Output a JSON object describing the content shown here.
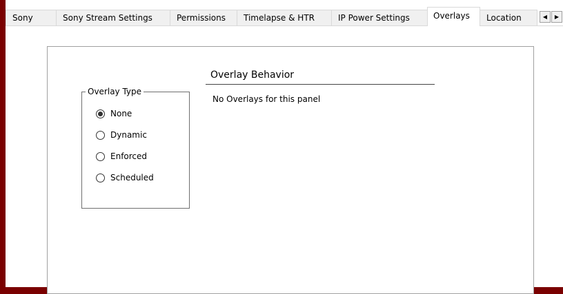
{
  "tabs": [
    {
      "label": "Sony",
      "selected": false
    },
    {
      "label": "Sony Stream Settings",
      "selected": false
    },
    {
      "label": "Permissions",
      "selected": false
    },
    {
      "label": "Timelapse & HTR",
      "selected": false
    },
    {
      "label": "IP Power Settings",
      "selected": false
    },
    {
      "label": "Overlays",
      "selected": true
    },
    {
      "label": "Location",
      "selected": false
    }
  ],
  "tab_scroll": {
    "left_icon": "triangle-left-icon",
    "right_icon": "triangle-right-icon"
  },
  "overlay_type": {
    "legend": "Overlay Type",
    "options": [
      {
        "label": "None",
        "checked": true
      },
      {
        "label": "Dynamic",
        "checked": false
      },
      {
        "label": "Enforced",
        "checked": false
      },
      {
        "label": "Scheduled",
        "checked": false
      }
    ]
  },
  "overlay_behavior": {
    "title": "Overlay Behavior",
    "message": "No Overlays for this panel"
  },
  "colors": {
    "window_frame": "#7a0000",
    "tab_background": "#f0f0f0",
    "panel_border": "#a0a0a0"
  }
}
